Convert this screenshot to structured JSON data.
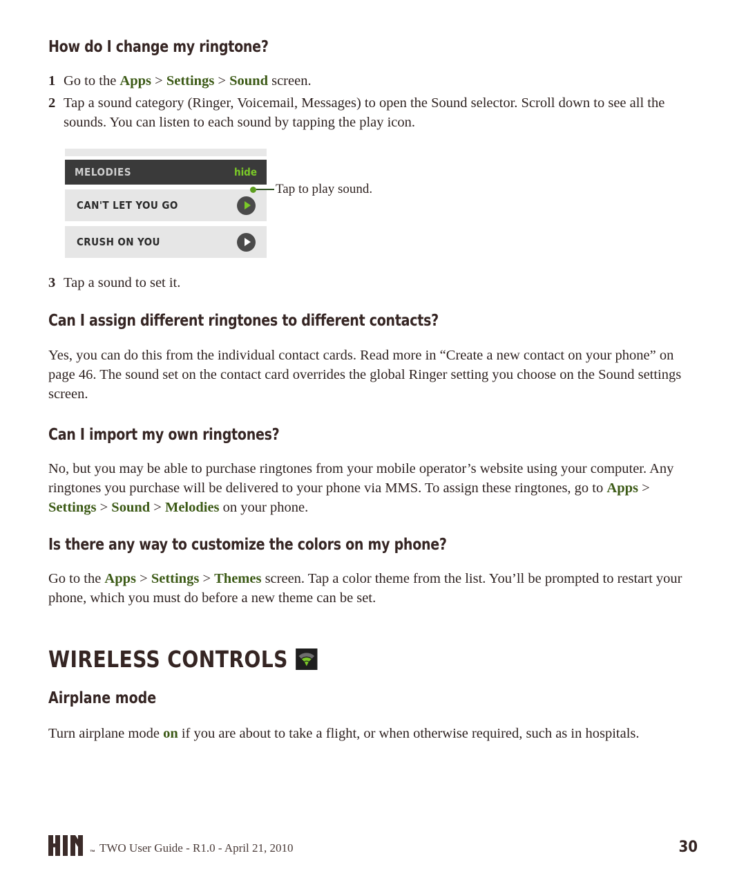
{
  "document": {
    "page_number": "30",
    "footer_text": "TWO User Guide - R1.0 - April 21, 2010",
    "logo_tm": "™"
  },
  "colors": {
    "accent_green": "#3c5a16",
    "bright_green": "#7bc928",
    "heading": "#352523",
    "body": "#2e2220",
    "bar_dark": "#3a3a3a",
    "row_gray": "#e6e6e6"
  },
  "sections": [
    {
      "heading": "How do I change my ringtone?",
      "steps": [
        {
          "number": "1",
          "parts": [
            {
              "t": "Go to the ",
              "style": "normal"
            },
            {
              "t": "Apps",
              "style": "nav"
            },
            {
              "t": " > ",
              "style": "sep"
            },
            {
              "t": "Settings",
              "style": "nav"
            },
            {
              "t": " > ",
              "style": "sep"
            },
            {
              "t": "Sound",
              "style": "nav"
            },
            {
              "t": " screen.",
              "style": "normal"
            }
          ]
        },
        {
          "number": "2",
          "parts": [
            {
              "t": "Tap a sound category (Ringer, Voicemail, Messages) to open the Sound selector. Scroll down to see all the sounds. You can listen to each sound by tapping the play icon.",
              "style": "normal"
            }
          ]
        },
        {
          "number": "3",
          "parts": [
            {
              "t": "Tap a sound to set it.",
              "style": "normal"
            }
          ]
        }
      ]
    },
    {
      "heading": "Can I assign different ringtones to different contacts?",
      "paragraph": "Yes, you can do this from the individual contact cards. Read more in “Create a new contact on your phone” on page 46. The sound set on the contact card overrides the global Ringer setting you choose on the Sound settings screen."
    },
    {
      "heading": "Can I import my own ringtones?",
      "parts": [
        {
          "t": "No, but you may be able to purchase ringtones from your mobile operator’s website using your computer. Any ringtones you purchase will be delivered to your phone via MMS. To assign these ringtones, go to ",
          "style": "normal"
        },
        {
          "t": "Apps",
          "style": "nav"
        },
        {
          "t": " > ",
          "style": "sep"
        },
        {
          "t": "Settings",
          "style": "nav"
        },
        {
          "t": " > ",
          "style": "sep"
        },
        {
          "t": "Sound",
          "style": "nav"
        },
        {
          "t": " > ",
          "style": "sep"
        },
        {
          "t": "Melodies",
          "style": "nav"
        },
        {
          "t": " on your phone.",
          "style": "normal"
        }
      ]
    },
    {
      "heading": "Is there any way to customize the colors on my phone?",
      "parts": [
        {
          "t": "Go to the ",
          "style": "normal"
        },
        {
          "t": "Apps",
          "style": "nav"
        },
        {
          "t": " > ",
          "style": "sep"
        },
        {
          "t": "Settings",
          "style": "nav"
        },
        {
          "t": " > ",
          "style": "sep"
        },
        {
          "t": "Themes",
          "style": "nav"
        },
        {
          "t": " screen. Tap a color theme from the list. You’ll be prompted to restart your phone, which you must do before a new theme can be set.",
          "style": "normal"
        }
      ]
    }
  ],
  "wireless_section": {
    "heading": "WIRELESS CONTROLS",
    "icon": "wifi-icon",
    "subheading": "Airplane mode",
    "parts": [
      {
        "t": "Turn airplane mode ",
        "style": "normal"
      },
      {
        "t": "on",
        "style": "nav"
      },
      {
        "t": " if you are about to take a flight, or when otherwise required, such as in hospitals.",
        "style": "normal"
      }
    ]
  },
  "melodies_widget": {
    "header_title": "MELODIES",
    "hide_label": "hide",
    "rows": [
      {
        "name": "CAN'T LET YOU GO",
        "play_icon": "play-icon",
        "highlighted": true
      },
      {
        "name": "CRUSH ON YOU",
        "play_icon": "play-icon",
        "highlighted": false
      }
    ],
    "callout": "Tap to play sound."
  }
}
